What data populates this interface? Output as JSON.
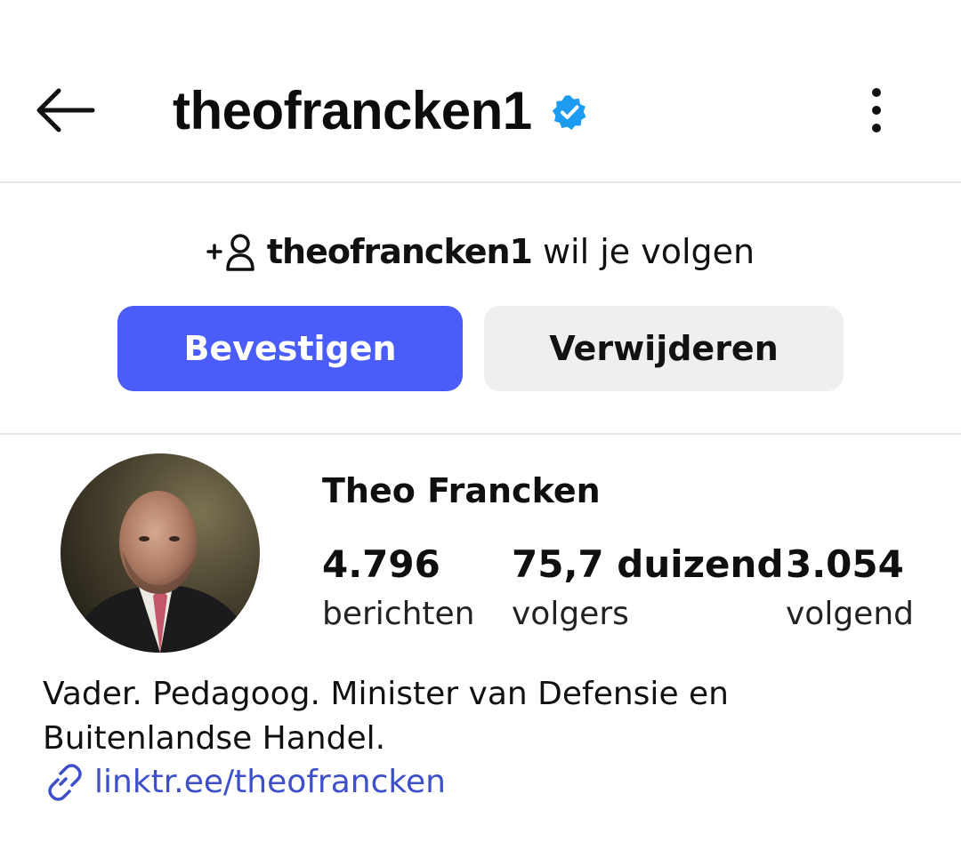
{
  "header": {
    "username": "theofrancken1",
    "verified": true,
    "back_icon": "arrow-left-icon",
    "more_icon": "more-vertical-icon",
    "verified_color": "#1d9bf0"
  },
  "follow_request": {
    "icon": "add-person-icon",
    "username": "theofrancken1",
    "text": "wil je volgen",
    "confirm_label": "Bevestigen",
    "remove_label": "Verwijderen",
    "confirm_color": "#4a5df9"
  },
  "profile": {
    "name": "Theo Francken",
    "stats": [
      {
        "value": "4.796",
        "label": "berichten"
      },
      {
        "value": "75,7 duizend",
        "label": "volgers"
      },
      {
        "value": "3.054",
        "label": "volgend"
      }
    ],
    "bio_lines": [
      "Vader. Pedagoog. Minister van Defensie en",
      "Buitenlandse Handel."
    ],
    "link": {
      "icon": "link-icon",
      "text": "linktr.ee/theofrancken",
      "color": "#3d4fc9"
    }
  }
}
